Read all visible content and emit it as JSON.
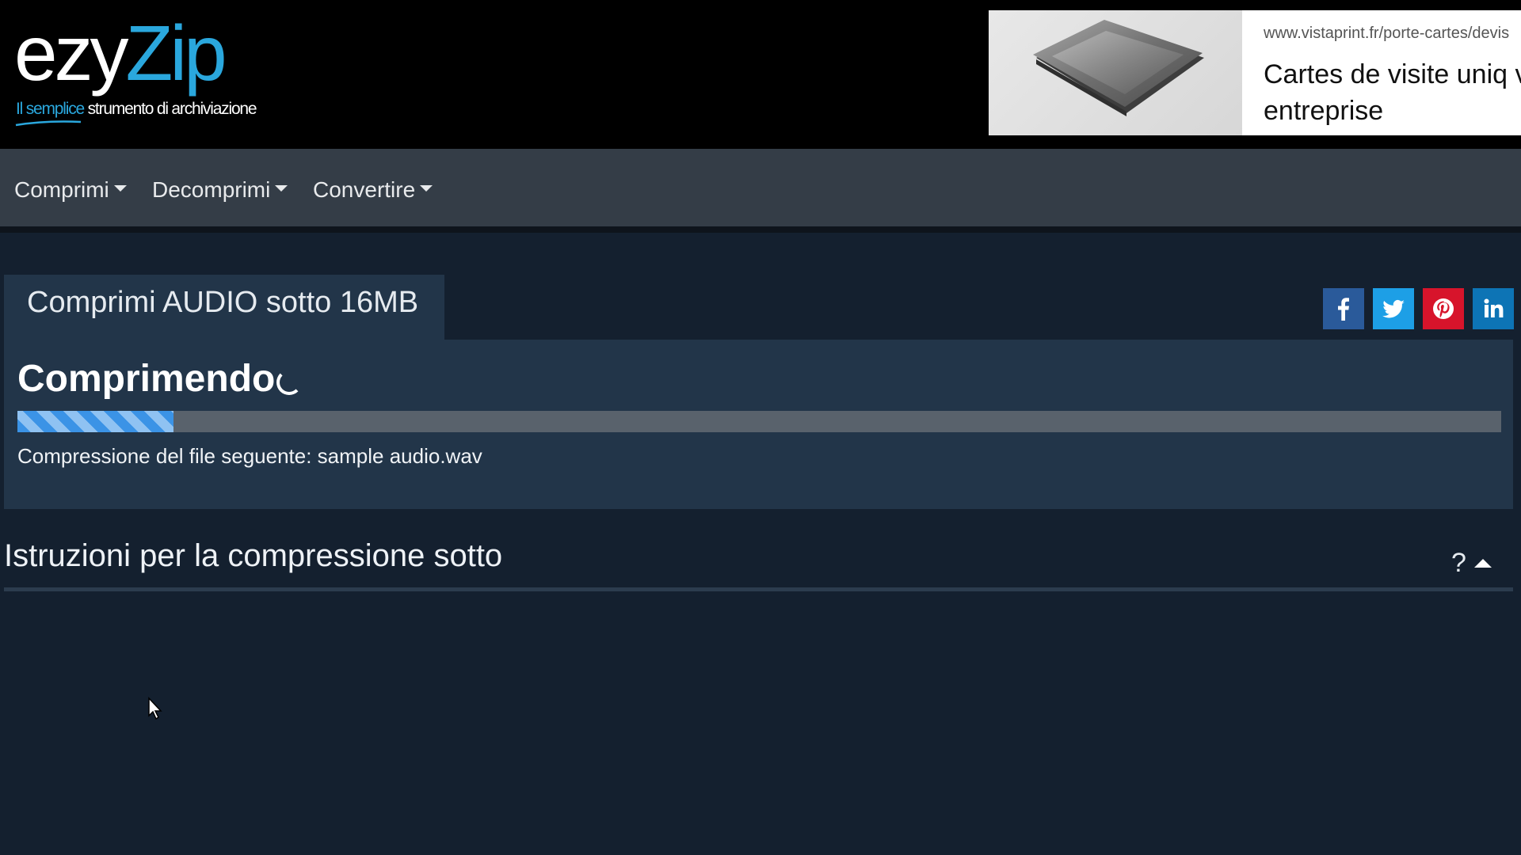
{
  "brand": {
    "logo_part1": "ezy",
    "logo_part2": "Zip",
    "tagline_em": "Il semplice",
    "tagline_rest": " strumento di archiviazione",
    "accent_color": "#2aa7dd"
  },
  "ad": {
    "url": "www.vistaprint.fr/porte-cartes/devis",
    "headline": "Cartes de visite uniq votre entreprise",
    "image_icon": "card-holder-image"
  },
  "nav": {
    "items": [
      {
        "label": "Comprimi"
      },
      {
        "label": "Decomprimi"
      },
      {
        "label": "Convertire"
      }
    ]
  },
  "tab": {
    "label": "Comprimi AUDIO sotto 16MB"
  },
  "social": [
    {
      "name": "facebook",
      "icon": "facebook-icon",
      "color": "#2a5a9a"
    },
    {
      "name": "twitter",
      "icon": "twitter-icon",
      "color": "#1d9fe6"
    },
    {
      "name": "pinterest",
      "icon": "pinterest-icon",
      "color": "#d7142b"
    },
    {
      "name": "linkedin",
      "icon": "linkedin-icon",
      "color": "#0d74b5"
    }
  ],
  "status": {
    "title": "Comprimendo",
    "progress": 0.105,
    "file_message": "Compressione del file seguente: sample audio.wav"
  },
  "instructions": {
    "title": "Istruzioni per la compressione sotto",
    "help": "?"
  }
}
